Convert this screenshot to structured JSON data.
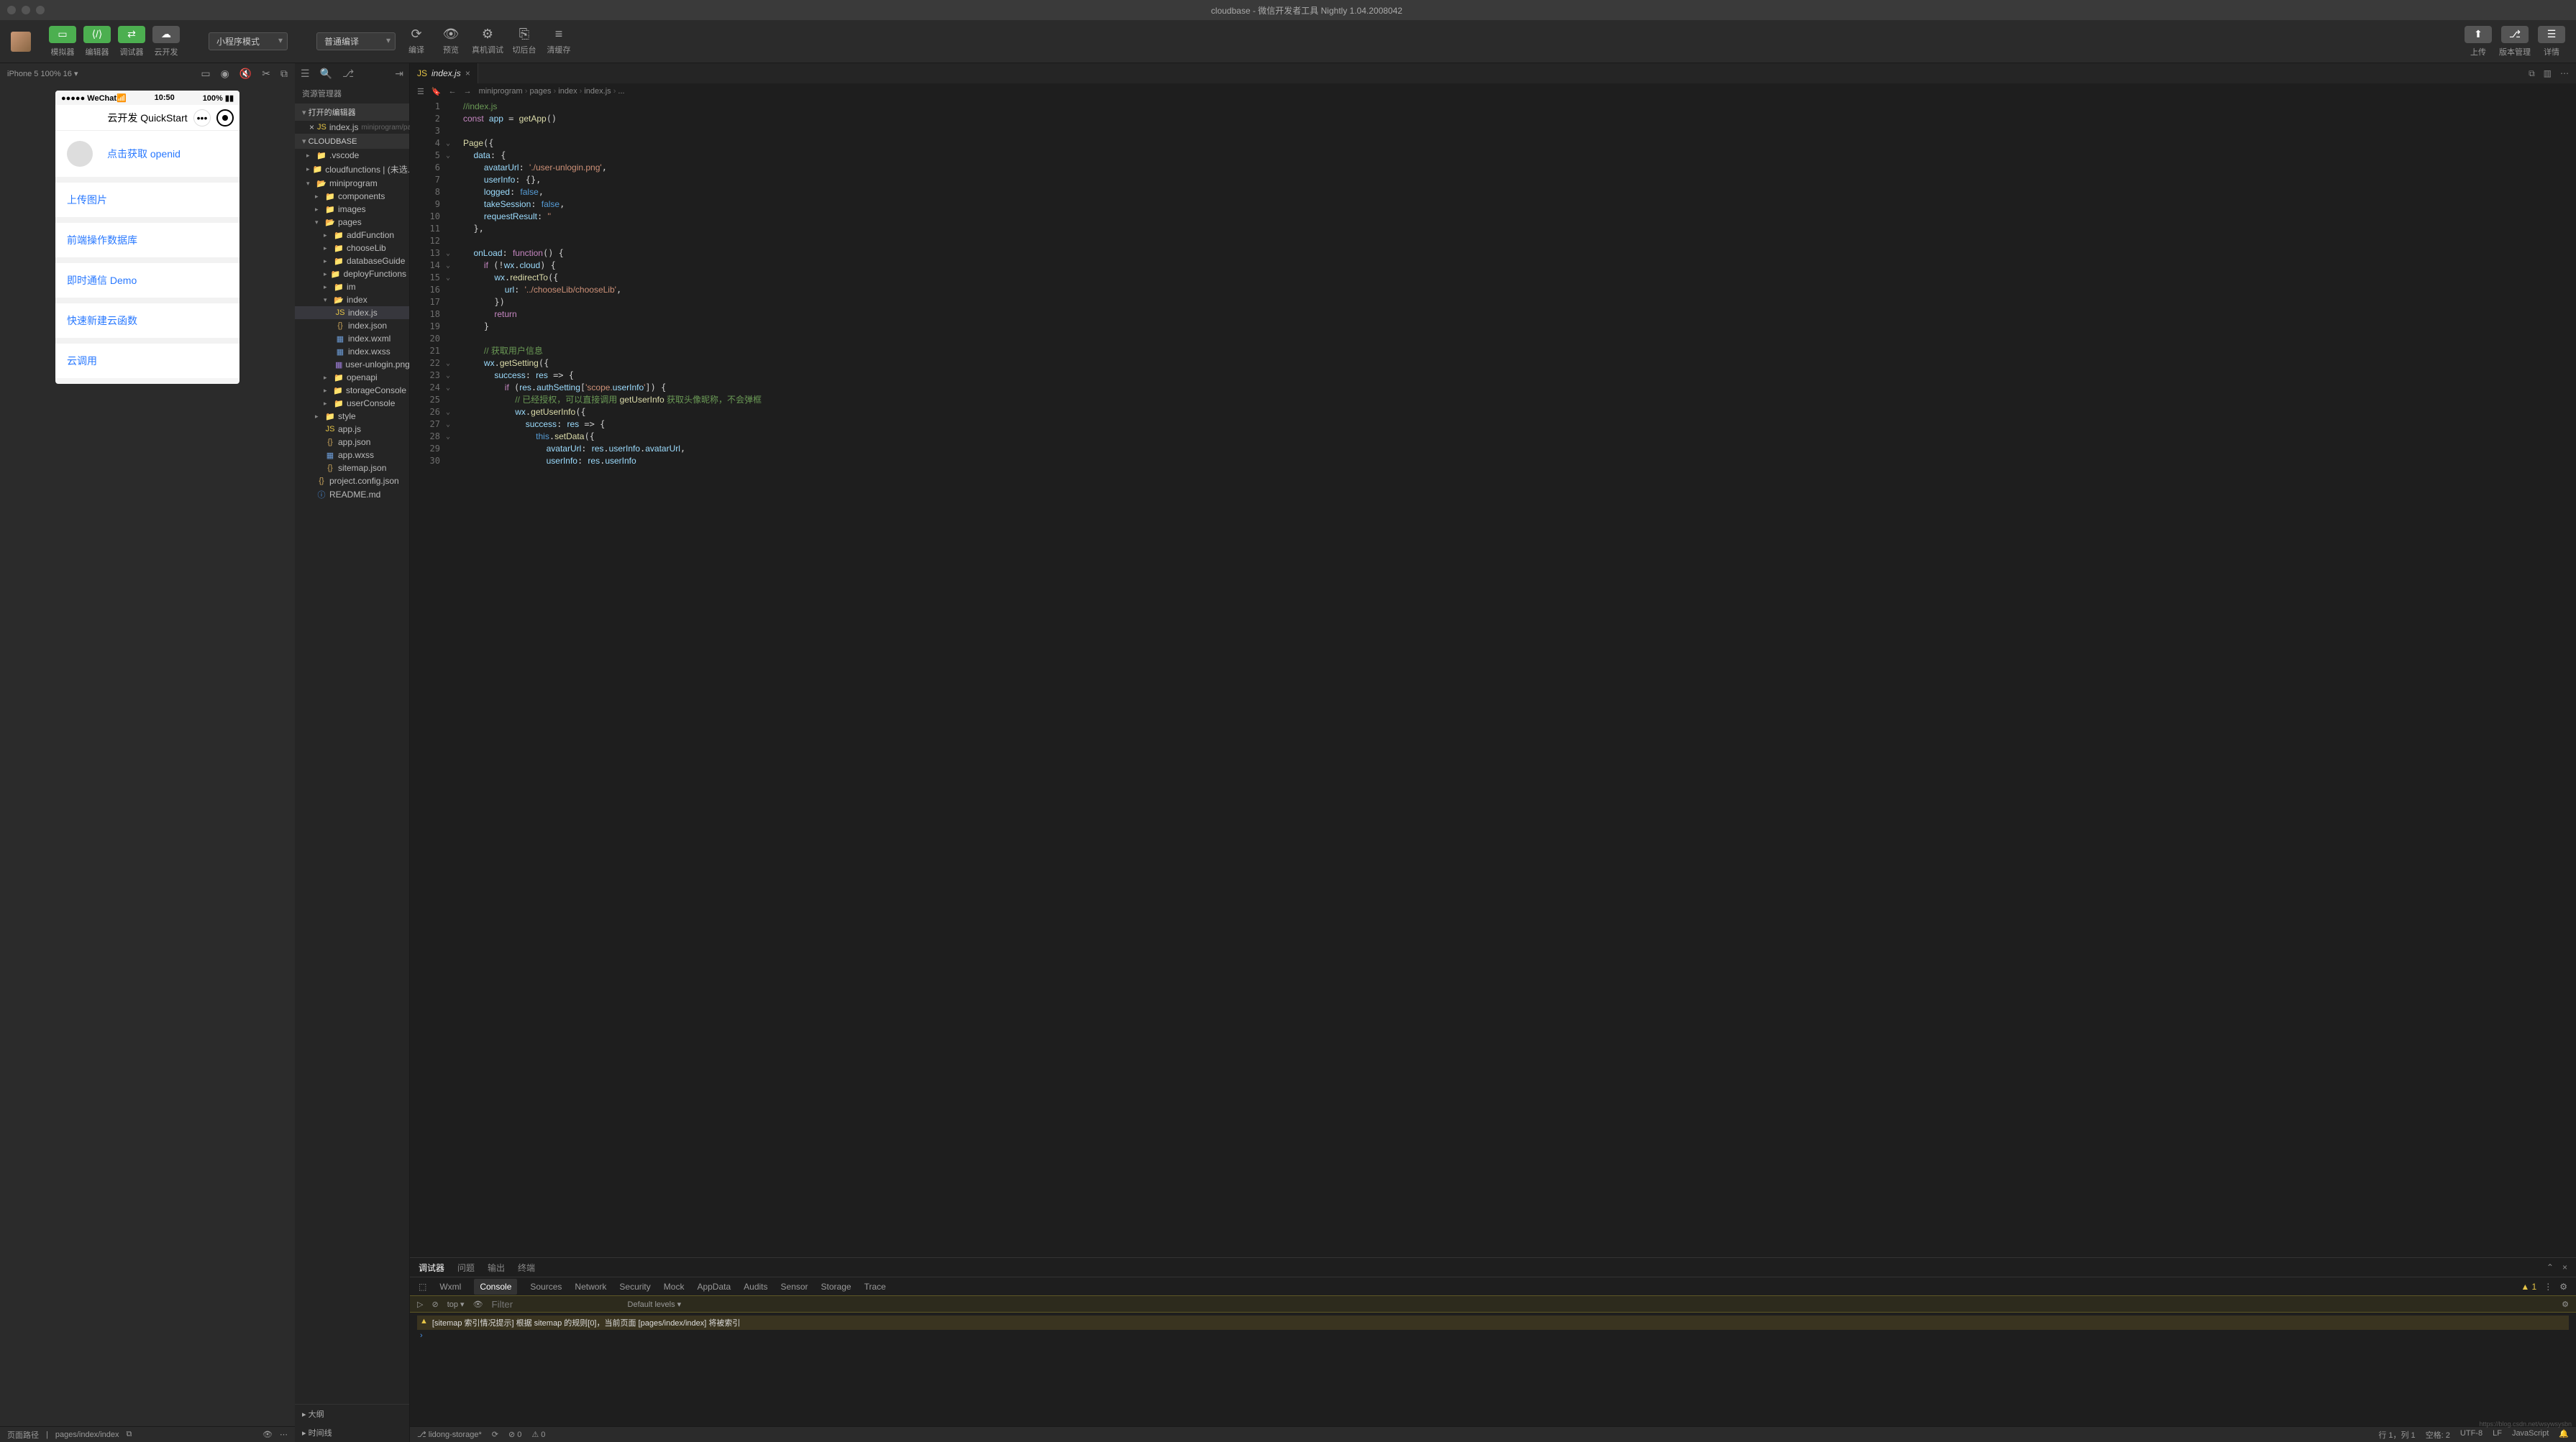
{
  "window": {
    "title_project": "cloudbase",
    "title_app": " - 微信开发者工具 Nightly 1.04.2008042"
  },
  "toolbar": {
    "simulator": "模拟器",
    "editor": "编辑器",
    "debugger": "调试器",
    "cloud_dev": "云开发",
    "mode": "小程序模式",
    "compile_mode": "普通编译",
    "compile": "编译",
    "preview": "预览",
    "remote_debug": "真机调试",
    "cut_backend": "切后台",
    "clear_cache": "清缓存",
    "upload": "上传",
    "version_mgmt": "版本管理",
    "details": "详情"
  },
  "simulator": {
    "device": "iPhone 5 100% 16",
    "phone_status_left": "●●●●● WeChat",
    "phone_status_time": "10:50",
    "phone_status_right": "100%",
    "phone_title": "云开发 QuickStart",
    "rows": {
      "openid": "点击获取 openid",
      "upload": "上传图片",
      "db": "前端操作数据库",
      "im": "即时通信 Demo",
      "func": "快速新建云函数",
      "invoke": "云调用"
    }
  },
  "explorer": {
    "header": "资源管理器",
    "sections": {
      "open_editors": "打开的编辑器",
      "project": "CLOUDBASE",
      "outline": "大纲",
      "timeline": "时间线"
    },
    "open_file": {
      "name": "index.js",
      "path": "miniprogram/pa..."
    },
    "tree": {
      "vscode": ".vscode",
      "cloudfunctions": "cloudfunctions | (未选...",
      "miniprogram": "miniprogram",
      "components": "components",
      "images": "images",
      "pages": "pages",
      "addFunction": "addFunction",
      "chooseLib": "chooseLib",
      "databaseGuide": "databaseGuide",
      "deployFunctions": "deployFunctions",
      "im": "im",
      "index": "index",
      "index_js": "index.js",
      "index_json": "index.json",
      "index_wxml": "index.wxml",
      "index_wxss": "index.wxss",
      "user_unlogin": "user-unlogin.png",
      "openapi": "openapi",
      "storageConsole": "storageConsole",
      "userConsole": "userConsole",
      "style": "style",
      "app_js": "app.js",
      "app_json": "app.json",
      "app_wxss": "app.wxss",
      "sitemap": "sitemap.json",
      "project_config": "project.config.json",
      "readme": "README.md"
    }
  },
  "editor": {
    "tab": "index.js",
    "breadcrumb": [
      "miniprogram",
      "pages",
      "index",
      "index.js",
      "..."
    ],
    "code_lines": [
      "//index.js",
      "const app = getApp()",
      "",
      "Page({",
      "  data: {",
      "    avatarUrl: './user-unlogin.png',",
      "    userInfo: {},",
      "    logged: false,",
      "    takeSession: false,",
      "    requestResult: ''",
      "  },",
      "",
      "  onLoad: function() {",
      "    if (!wx.cloud) {",
      "      wx.redirectTo({",
      "        url: '../chooseLib/chooseLib',",
      "      })",
      "      return",
      "    }",
      "",
      "    // 获取用户信息",
      "    wx.getSetting({",
      "      success: res => {",
      "        if (res.authSetting['scope.userInfo']) {",
      "          // 已经授权，可以直接调用 getUserInfo 获取头像昵称，不会弹框",
      "          wx.getUserInfo({",
      "            success: res => {",
      "              this.setData({",
      "                avatarUrl: res.userInfo.avatarUrl,",
      "                userInfo: res.userInfo"
    ],
    "fold_marks": {
      "4": "⌄",
      "5": "⌄",
      "6": "",
      "13": "⌄",
      "14": "⌄",
      "15": "⌄",
      "22": "⌄",
      "23": "⌄",
      "24": "⌄",
      "26": "⌄",
      "27": "⌄",
      "28": "⌄"
    }
  },
  "panel": {
    "tabs": {
      "debugger": "调试器",
      "problems": "问题",
      "output": "输出",
      "terminal": "终端"
    },
    "devtabs": {
      "wxml": "Wxml",
      "console": "Console",
      "sources": "Sources",
      "network": "Network",
      "security": "Security",
      "mock": "Mock",
      "appdata": "AppData",
      "audits": "Audits",
      "sensor": "Sensor",
      "storage": "Storage",
      "trace": "Trace"
    },
    "warn_count": "1",
    "console_top": "top",
    "console_filter_placeholder": "Filter",
    "console_levels": "Default levels ▾",
    "console_msg": "[sitemap 索引情况提示] 根据 sitemap 的规则[0]，当前页面 [pages/index/index] 将被索引"
  },
  "statusbar": {
    "branch": "lidong-storage*",
    "sync": "⟳",
    "errors": "⊘ 0",
    "warnings": "⚠ 0",
    "line_col": "行 1，列 1",
    "spaces": "空格: 2",
    "encoding": "UTF-8",
    "eol": "LF",
    "lang": "JavaScript",
    "bell": "🔔"
  },
  "sim_status": {
    "label": "页面路径",
    "path": "pages/index/index"
  },
  "watermark": "https://blog.csdn.net/wsywsysbn"
}
